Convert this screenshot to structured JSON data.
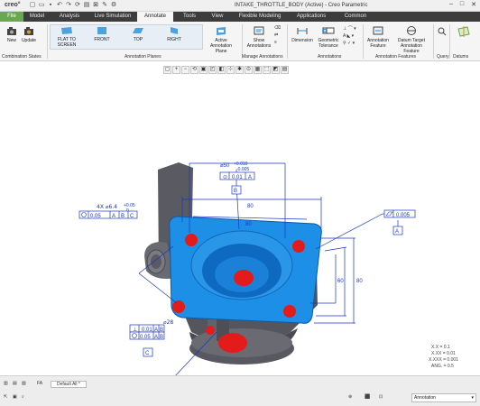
{
  "app": {
    "logo": "creo°",
    "window_title": "INTAKE_THROTTLE_BODY (Active) - Creo Parametric",
    "window_controls": [
      "–",
      "□",
      "✕"
    ]
  },
  "tabs": [
    "File",
    "Model",
    "Analysis",
    "Live Simulation",
    "Annotate",
    "Tools",
    "View",
    "Flexible Modeling",
    "Applications",
    "Common"
  ],
  "active_tab": "Annotate",
  "ribbon": {
    "combination_states": {
      "new": "New",
      "update": "Update",
      "group": "Combination States"
    },
    "annotation_planes": {
      "flat_to_screen": "FLAT TO SCREEN",
      "front": "FRONT",
      "top": "TOP",
      "right": "RIGHT",
      "active_plane": "Active Annotation Plane",
      "group": "Annotation Planes"
    },
    "manage_annotations": {
      "show": "Show Annotations",
      "group": "Manage Annotations"
    },
    "annotations": {
      "dimension": "Dimension",
      "geometric_tolerance": "Geometric Tolerance",
      "group": "Annotations"
    },
    "annotation_features": {
      "annotation_feature": "Annotation Feature",
      "datum_target": "Datum Target Annotation Feature",
      "group": "Annotation Features"
    },
    "query": {
      "group": "Query"
    },
    "datums": {
      "group": "Datums"
    }
  },
  "model_annotations": {
    "top_dim": "⌀50",
    "top_tol_upper": "+0.010",
    "top_tol_lower": "-0.005",
    "top_fcf_symbol": "⊙",
    "top_fcf_value": "0.01",
    "top_fcf_datum": "A",
    "datum_b": "B",
    "dim_80_outer": "80",
    "dim_80_inner": "80",
    "dim_60_inner": "60",
    "dim_80_right": "80",
    "flatness_value": "0.005",
    "datum_a": "A",
    "holes_note": "4X ⌀6.4",
    "holes_tol": "+0.05",
    "holes_tol2": "0",
    "holes_fcf_value": "0.05",
    "holes_fcf_datums": [
      "A",
      "B",
      "C"
    ],
    "bore_dim": "⌀28",
    "bore_fcf1_value": "0.01",
    "bore_fcf1_datums": [
      "A",
      "B"
    ],
    "bore_fcf2_value": "0.05",
    "bore_fcf2_datums": [
      "A",
      "B"
    ],
    "datum_c": "C"
  },
  "tolerance_note": {
    "line1": "X.X = 0.1",
    "line2": "X.XX = 0.01",
    "line3": "X.XXX = 0.001",
    "line4": "ANG. = 0.5"
  },
  "status": {
    "layer_tab": "FA",
    "default_all": "Default All *",
    "filter": "Annotation"
  },
  "colors": {
    "face_blue": "#1e8fe6",
    "hole_red": "#e41b1b",
    "body_gray": "#5a5a62",
    "annotation_blue": "#1a35c8",
    "file_tab_green": "#6aa84f"
  }
}
